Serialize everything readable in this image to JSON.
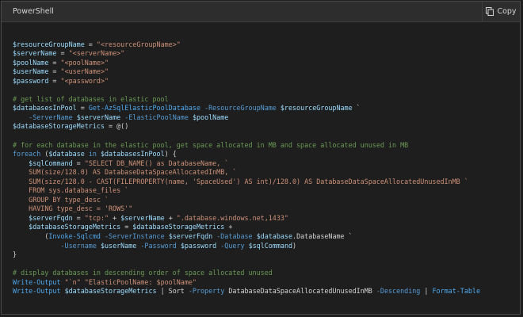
{
  "header": {
    "language_label": "PowerShell",
    "copy_label": "Copy",
    "copy_icon": "copy-icon"
  },
  "code_lines": [
    [],
    [
      [
        "var",
        "$resourceGroupName"
      ],
      [
        "plain",
        " = "
      ],
      [
        "str",
        "\"<resourceGroupName>\""
      ]
    ],
    [
      [
        "var",
        "$serverName"
      ],
      [
        "plain",
        " = "
      ],
      [
        "str",
        "\"<serverName>\""
      ]
    ],
    [
      [
        "var",
        "$poolName"
      ],
      [
        "plain",
        " = "
      ],
      [
        "str",
        "\"<poolName>\""
      ]
    ],
    [
      [
        "var",
        "$userName"
      ],
      [
        "plain",
        " = "
      ],
      [
        "str",
        "\"<userName>\""
      ]
    ],
    [
      [
        "var",
        "$password"
      ],
      [
        "plain",
        " = "
      ],
      [
        "str",
        "\"<password>\""
      ]
    ],
    [],
    [
      [
        "cmt",
        "# get list of databases in elastic pool"
      ]
    ],
    [
      [
        "var",
        "$databasesInPool"
      ],
      [
        "plain",
        " = "
      ],
      [
        "cmd",
        "Get-AzSqlElasticPoolDatabase"
      ],
      [
        "plain",
        " "
      ],
      [
        "par",
        "-ResourceGroupName"
      ],
      [
        "plain",
        " "
      ],
      [
        "var",
        "$resourceGroupName"
      ],
      [
        "plain",
        " `"
      ]
    ],
    [
      [
        "plain",
        "    "
      ],
      [
        "par",
        "-ServerName"
      ],
      [
        "plain",
        " "
      ],
      [
        "var",
        "$serverName"
      ],
      [
        "plain",
        " "
      ],
      [
        "par",
        "-ElasticPoolName"
      ],
      [
        "plain",
        " "
      ],
      [
        "var",
        "$poolName"
      ]
    ],
    [
      [
        "var",
        "$databaseStorageMetrics"
      ],
      [
        "plain",
        " = @()"
      ]
    ],
    [],
    [
      [
        "cmt",
        "# for each database in the elastic pool, get space allocated in MB and space allocated unused in MB"
      ]
    ],
    [
      [
        "kw",
        "foreach"
      ],
      [
        "plain",
        " ("
      ],
      [
        "var",
        "$database"
      ],
      [
        "plain",
        " "
      ],
      [
        "kw",
        "in"
      ],
      [
        "plain",
        " "
      ],
      [
        "var",
        "$databasesInPool"
      ],
      [
        "plain",
        ") {"
      ]
    ],
    [
      [
        "plain",
        "    "
      ],
      [
        "var",
        "$sqlCommand"
      ],
      [
        "plain",
        " = "
      ],
      [
        "str",
        "\"SELECT DB_NAME() as DatabaseName, `"
      ]
    ],
    [
      [
        "str",
        "    SUM(size/128.0) AS DatabaseDataSpaceAllocatedInMB, `"
      ]
    ],
    [
      [
        "str",
        "    SUM(size/128.0 - CAST(FILEPROPERTY(name, 'SpaceUsed') AS int)/128.0) AS DatabaseDataSpaceAllocatedUnusedInMB `"
      ]
    ],
    [
      [
        "str",
        "    FROM sys.database_files `"
      ]
    ],
    [
      [
        "str",
        "    GROUP BY type_desc `"
      ]
    ],
    [
      [
        "str",
        "    HAVING type_desc = 'ROWS'\""
      ]
    ],
    [
      [
        "plain",
        "    "
      ],
      [
        "var",
        "$serverFqdn"
      ],
      [
        "plain",
        " = "
      ],
      [
        "str",
        "\"tcp:\""
      ],
      [
        "plain",
        " + "
      ],
      [
        "var",
        "$serverName"
      ],
      [
        "plain",
        " + "
      ],
      [
        "str",
        "\".database.windows.net,1433\""
      ]
    ],
    [
      [
        "plain",
        "    "
      ],
      [
        "var",
        "$databaseStorageMetrics"
      ],
      [
        "plain",
        " = "
      ],
      [
        "var",
        "$databaseStorageMetrics"
      ],
      [
        "plain",
        " +"
      ]
    ],
    [
      [
        "plain",
        "        ("
      ],
      [
        "cmd",
        "Invoke-Sqlcmd"
      ],
      [
        "plain",
        " "
      ],
      [
        "par",
        "-ServerInstance"
      ],
      [
        "plain",
        " "
      ],
      [
        "var",
        "$serverFqdn"
      ],
      [
        "plain",
        " "
      ],
      [
        "par",
        "-Database"
      ],
      [
        "plain",
        " "
      ],
      [
        "var",
        "$database"
      ],
      [
        "plain",
        ".DatabaseName `"
      ]
    ],
    [
      [
        "plain",
        "            "
      ],
      [
        "par",
        "-Username"
      ],
      [
        "plain",
        " "
      ],
      [
        "var",
        "$userName"
      ],
      [
        "plain",
        " "
      ],
      [
        "par",
        "-Password"
      ],
      [
        "plain",
        " "
      ],
      [
        "var",
        "$password"
      ],
      [
        "plain",
        " "
      ],
      [
        "par",
        "-Query"
      ],
      [
        "plain",
        " "
      ],
      [
        "var",
        "$sqlCommand"
      ],
      [
        "plain",
        ")"
      ]
    ],
    [
      [
        "plain",
        "}"
      ]
    ],
    [],
    [
      [
        "cmt",
        "# display databases in descending order of space allocated unused"
      ]
    ],
    [
      [
        "cmd",
        "Write-Output"
      ],
      [
        "plain",
        " "
      ],
      [
        "str",
        "\"`n\" \"ElasticPoolName: $poolName\""
      ]
    ],
    [
      [
        "cmd",
        "Write-Output"
      ],
      [
        "plain",
        " "
      ],
      [
        "var",
        "$databaseStorageMetrics"
      ],
      [
        "plain",
        " | Sort "
      ],
      [
        "par",
        "-Property"
      ],
      [
        "plain",
        " DatabaseDataSpaceAllocatedUnusedInMB "
      ],
      [
        "par",
        "-Descending"
      ],
      [
        "plain",
        " | "
      ],
      [
        "cmd",
        "Format-Table"
      ]
    ]
  ]
}
